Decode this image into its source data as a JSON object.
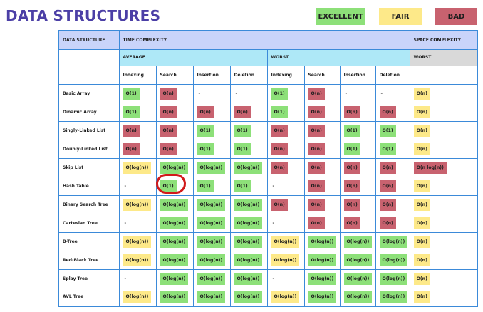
{
  "title": "DATA STRUCTURES",
  "legend": {
    "excellent": "EXCELLENT",
    "fair": "FAIR",
    "bad": "BAD"
  },
  "colors": {
    "title": "#4b3fa6",
    "excellent": "#8de079",
    "fair": "#fde989",
    "bad": "#c8626f",
    "border": "#3b8ad9",
    "header": "#c9d4fa",
    "subheader": "#aee8f7",
    "highlight_circle": "#d11a1a"
  },
  "table": {
    "header": {
      "data_structure": "DATA STRUCTURE",
      "time_complexity": "TIME COMPLEXITY",
      "space_complexity": "SPACE COMPLEXITY"
    },
    "subheader": {
      "average": "AVERAGE",
      "worst": "WORST",
      "space_worst": "WORST"
    },
    "columns": [
      "Indexing",
      "Search",
      "Insertion",
      "Deletion",
      "Indexing",
      "Search",
      "Insertion",
      "Deletion"
    ],
    "rows": [
      {
        "name": "Basic Array",
        "cells": [
          {
            "v": "O(1)",
            "c": "green"
          },
          {
            "v": "O(n)",
            "c": "red"
          },
          {
            "v": "-",
            "c": "none"
          },
          {
            "v": "-",
            "c": "none"
          },
          {
            "v": "O(1)",
            "c": "green"
          },
          {
            "v": "O(n)",
            "c": "red"
          },
          {
            "v": "-",
            "c": "none"
          },
          {
            "v": "-",
            "c": "none"
          },
          {
            "v": "O(n)",
            "c": "yellow"
          }
        ]
      },
      {
        "name": "Dinamic Array",
        "cells": [
          {
            "v": "O(1)",
            "c": "green"
          },
          {
            "v": "O(n)",
            "c": "red"
          },
          {
            "v": "O(n)",
            "c": "red"
          },
          {
            "v": "O(n)",
            "c": "red"
          },
          {
            "v": "O(1)",
            "c": "green"
          },
          {
            "v": "O(n)",
            "c": "red"
          },
          {
            "v": "O(n)",
            "c": "red"
          },
          {
            "v": "O(n)",
            "c": "red"
          },
          {
            "v": "O(n)",
            "c": "yellow"
          }
        ]
      },
      {
        "name": "Singly-Linked List",
        "cells": [
          {
            "v": "O(n)",
            "c": "red"
          },
          {
            "v": "O(n)",
            "c": "red"
          },
          {
            "v": "O(1)",
            "c": "green"
          },
          {
            "v": "O(1)",
            "c": "green"
          },
          {
            "v": "O(n)",
            "c": "red"
          },
          {
            "v": "O(n)",
            "c": "red"
          },
          {
            "v": "O(1)",
            "c": "green"
          },
          {
            "v": "O(1)",
            "c": "green"
          },
          {
            "v": "O(n)",
            "c": "yellow"
          }
        ]
      },
      {
        "name": "Doubly-Linked List",
        "cells": [
          {
            "v": "O(n)",
            "c": "red"
          },
          {
            "v": "O(n)",
            "c": "red"
          },
          {
            "v": "O(1)",
            "c": "green"
          },
          {
            "v": "O(1)",
            "c": "green"
          },
          {
            "v": "O(n)",
            "c": "red"
          },
          {
            "v": "O(n)",
            "c": "red"
          },
          {
            "v": "O(1)",
            "c": "green"
          },
          {
            "v": "O(1)",
            "c": "green"
          },
          {
            "v": "O(n)",
            "c": "yellow"
          }
        ]
      },
      {
        "name": "Skip List",
        "cells": [
          {
            "v": "O(log(n))",
            "c": "yellow"
          },
          {
            "v": "O(log(n))",
            "c": "green"
          },
          {
            "v": "O(log(n))",
            "c": "green"
          },
          {
            "v": "O(log(n))",
            "c": "green"
          },
          {
            "v": "O(n)",
            "c": "red"
          },
          {
            "v": "O(n)",
            "c": "red"
          },
          {
            "v": "O(n)",
            "c": "red"
          },
          {
            "v": "O(n)",
            "c": "red"
          },
          {
            "v": "O(n log(n))",
            "c": "red"
          }
        ]
      },
      {
        "name": "Hash Table",
        "cells": [
          {
            "v": "-",
            "c": "none"
          },
          {
            "v": "O(1)",
            "c": "green"
          },
          {
            "v": "O(1)",
            "c": "green"
          },
          {
            "v": "O(1)",
            "c": "green"
          },
          {
            "v": "-",
            "c": "none"
          },
          {
            "v": "O(n)",
            "c": "red"
          },
          {
            "v": "O(n)",
            "c": "red"
          },
          {
            "v": "O(n)",
            "c": "red"
          },
          {
            "v": "O(n)",
            "c": "yellow"
          }
        ]
      },
      {
        "name": "Binary Search Tree",
        "cells": [
          {
            "v": "O(log(n))",
            "c": "yellow"
          },
          {
            "v": "O(log(n))",
            "c": "green"
          },
          {
            "v": "O(log(n))",
            "c": "green"
          },
          {
            "v": "O(log(n))",
            "c": "green"
          },
          {
            "v": "O(n)",
            "c": "red"
          },
          {
            "v": "O(n)",
            "c": "red"
          },
          {
            "v": "O(n)",
            "c": "red"
          },
          {
            "v": "O(n)",
            "c": "red"
          },
          {
            "v": "O(n)",
            "c": "yellow"
          }
        ]
      },
      {
        "name": "Cartesian Tree",
        "cells": [
          {
            "v": "-",
            "c": "none"
          },
          {
            "v": "O(log(n))",
            "c": "green"
          },
          {
            "v": "O(log(n))",
            "c": "green"
          },
          {
            "v": "O(log(n))",
            "c": "green"
          },
          {
            "v": "-",
            "c": "none"
          },
          {
            "v": "O(n)",
            "c": "red"
          },
          {
            "v": "O(n)",
            "c": "red"
          },
          {
            "v": "O(n)",
            "c": "red"
          },
          {
            "v": "O(n)",
            "c": "yellow"
          }
        ]
      },
      {
        "name": "B-Tree",
        "cells": [
          {
            "v": "O(log(n))",
            "c": "yellow"
          },
          {
            "v": "O(log(n))",
            "c": "green"
          },
          {
            "v": "O(log(n))",
            "c": "green"
          },
          {
            "v": "O(log(n))",
            "c": "green"
          },
          {
            "v": "O(log(n))",
            "c": "yellow"
          },
          {
            "v": "O(log(n))",
            "c": "green"
          },
          {
            "v": "O(log(n))",
            "c": "green"
          },
          {
            "v": "O(log(n))",
            "c": "green"
          },
          {
            "v": "O(n)",
            "c": "yellow"
          }
        ]
      },
      {
        "name": "Red-Black Tree",
        "cells": [
          {
            "v": "O(log(n))",
            "c": "yellow"
          },
          {
            "v": "O(log(n))",
            "c": "green"
          },
          {
            "v": "O(log(n))",
            "c": "green"
          },
          {
            "v": "O(log(n))",
            "c": "green"
          },
          {
            "v": "O(log(n))",
            "c": "yellow"
          },
          {
            "v": "O(log(n))",
            "c": "green"
          },
          {
            "v": "O(log(n))",
            "c": "green"
          },
          {
            "v": "O(log(n))",
            "c": "green"
          },
          {
            "v": "O(n)",
            "c": "yellow"
          }
        ]
      },
      {
        "name": "Splay Tree",
        "cells": [
          {
            "v": "-",
            "c": "none"
          },
          {
            "v": "O(log(n))",
            "c": "green"
          },
          {
            "v": "O(log(n))",
            "c": "green"
          },
          {
            "v": "O(log(n))",
            "c": "green"
          },
          {
            "v": "-",
            "c": "none"
          },
          {
            "v": "O(log(n))",
            "c": "green"
          },
          {
            "v": "O(log(n))",
            "c": "green"
          },
          {
            "v": "O(log(n))",
            "c": "green"
          },
          {
            "v": "O(n)",
            "c": "yellow"
          }
        ]
      },
      {
        "name": "AVL Tree",
        "cells": [
          {
            "v": "O(log(n))",
            "c": "yellow"
          },
          {
            "v": "O(log(n))",
            "c": "green"
          },
          {
            "v": "O(log(n))",
            "c": "green"
          },
          {
            "v": "O(log(n))",
            "c": "green"
          },
          {
            "v": "O(log(n))",
            "c": "yellow"
          },
          {
            "v": "O(log(n))",
            "c": "green"
          },
          {
            "v": "O(log(n))",
            "c": "green"
          },
          {
            "v": "O(log(n))",
            "c": "green"
          },
          {
            "v": "O(n)",
            "c": "yellow"
          }
        ]
      }
    ]
  }
}
